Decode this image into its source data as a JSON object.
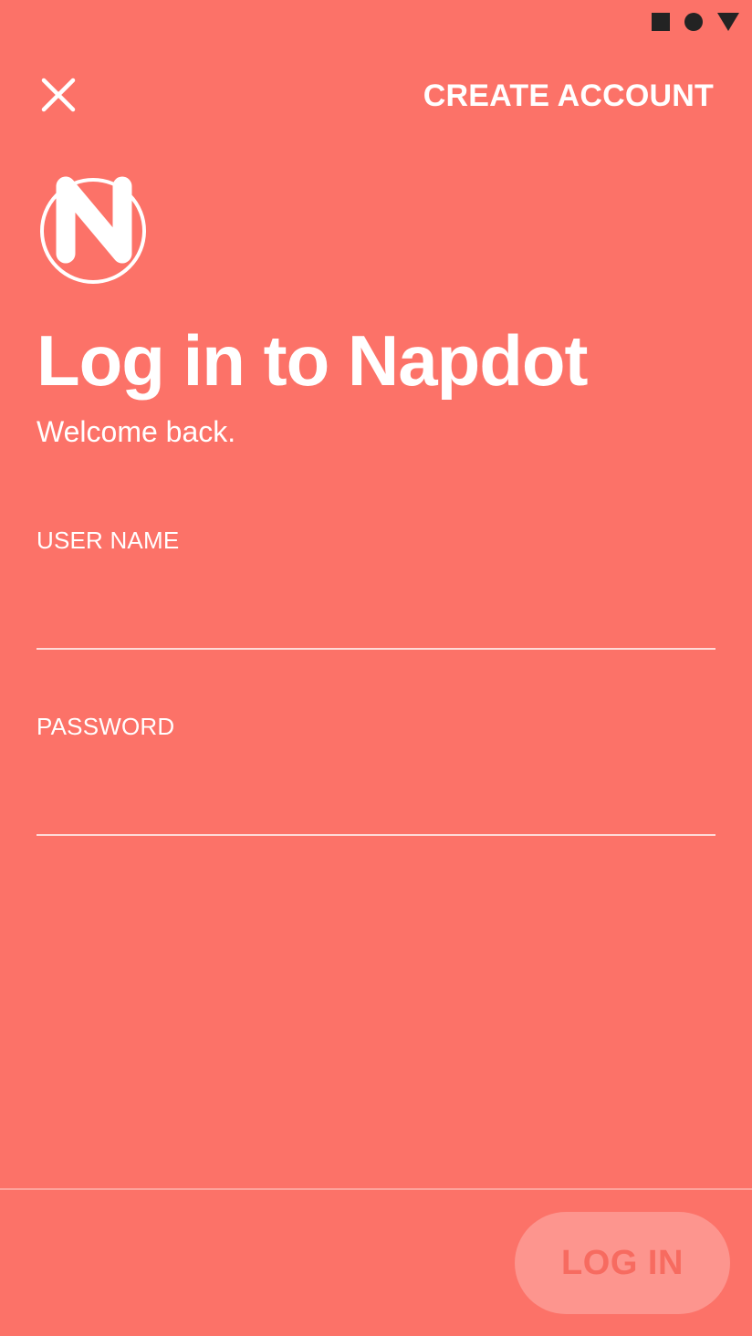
{
  "status_bar": {
    "icons": [
      "stop-icon",
      "record-icon",
      "signal-icon"
    ],
    "color": "#232323"
  },
  "header": {
    "close_icon": "close-icon",
    "create_account_label": "CREATE ACCOUNT"
  },
  "logo": {
    "letter": "N",
    "icon": "napdot-logo-icon"
  },
  "title": "Log in to Napdot",
  "subtitle": "Welcome back.",
  "form": {
    "username": {
      "label": "USER NAME",
      "value": ""
    },
    "password": {
      "label": "PASSWORD",
      "value": ""
    }
  },
  "footer": {
    "login_label": "LOG IN"
  },
  "colors": {
    "background": "#FC7268",
    "text": "#FFFFFF",
    "button_text": "#F76B60"
  }
}
